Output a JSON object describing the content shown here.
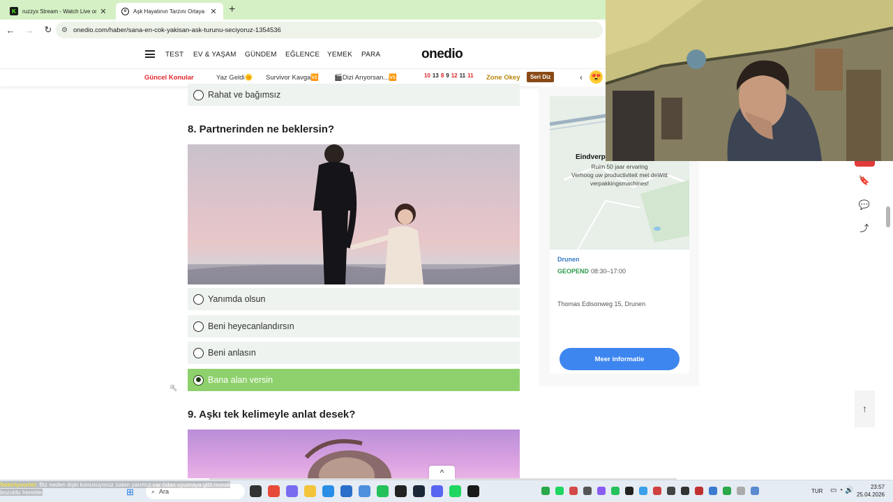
{
  "browser": {
    "tabs": [
      {
        "title": "ruzzyx Stream - Watch Live on Kick",
        "active": false
      },
      {
        "title": "Aşk Hayatının Tarzını Ortaya Çıkaracak",
        "active": true
      }
    ],
    "url": "onedio.com/haber/sana-en-cok-yakisan-ask-turunu-seciyoruz-1354536"
  },
  "site": {
    "logo": "onedio",
    "nav": [
      "TEST",
      "EV & YAŞAM",
      "GÜNDEM",
      "EĞLENCE",
      "YEMEK",
      "PARA"
    ],
    "topics": {
      "label": "Güncel Konular",
      "items": [
        "Yaz Geldi🌞",
        "Survivor Kavga🆚",
        "🎬Dizi Arıyorsan...🆚"
      ],
      "numbers": [
        "10",
        "13",
        "8",
        "9",
        "12",
        "11",
        "11"
      ],
      "zone": "Zone Okey",
      "badge": "Seri Diz"
    }
  },
  "quiz": {
    "prev_option": "Rahat ve bağımsız",
    "q8": {
      "title": "8. Partnerinden ne beklersin?",
      "options": [
        {
          "label": "Yanımda olsun",
          "selected": false
        },
        {
          "label": "Beni heyecanlandırsın",
          "selected": false
        },
        {
          "label": "Beni anlasın",
          "selected": false
        },
        {
          "label": "Bana alan versin",
          "selected": true
        }
      ]
    },
    "q9": {
      "title": "9. Aşkı tek kelimeyle anlat desek?"
    }
  },
  "ad": {
    "title": "Eindverpa",
    "line1": "Ruim 50 jaar ervaring",
    "line2": "Verhoog uw productiviteit met deWitt",
    "line3": "verpakkingsmachines!",
    "location": "Drunen",
    "status": "GEOPEND",
    "hours": "08:30–17:00",
    "address": "Thomas Edisonweg 15, Drunen",
    "button": "Meer informatie"
  },
  "chat": {
    "user": "Sekiriyourtei",
    "message": ": Biz neden ilişki konusuyoruz zaten yarımız var ödan uyumaya gitti morali bozuldu herelde"
  },
  "taskbar": {
    "search": "Ara",
    "lang": "TUR",
    "time": "23:57",
    "date": "25.04.2026"
  },
  "colors": {
    "tabbar": "#d4f0c4",
    "selected_option": "#8ed16c",
    "option_bg": "#eef3ef",
    "ad_button": "#3e86ef",
    "hot_topic": "#e3262d"
  }
}
